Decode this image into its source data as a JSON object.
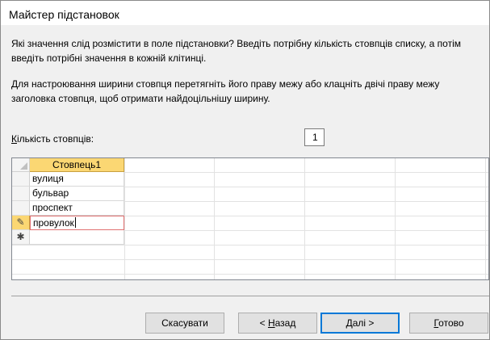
{
  "window": {
    "title": "Майстер підстановок"
  },
  "instructions": {
    "line1a": "Які значення слід розмістити в поле підстановки? Введіть потрібну кількість стовпців списку, а потім",
    "line1b": "введіть потрібні значення в кожній клітинці.",
    "line2a": "Для настроювання ширини стовпця перетягніть його праву межу або клацніть двічі праву межу",
    "line2b": "заголовка стовпця, щоб отримати найдоцільнішу ширину."
  },
  "column_count": {
    "label_accel": "К",
    "label_rest": "ількість стовпців:",
    "value": "1"
  },
  "grid": {
    "column_header": "Стовпець1",
    "rows": [
      "вулиця",
      "бульвар",
      "проспект",
      "провулок",
      ""
    ],
    "row_selectors": [
      "",
      "",
      "",
      "✎",
      "✱"
    ]
  },
  "buttons": {
    "cancel": "Скасувати",
    "back_prefix": "< ",
    "back_accel": "Н",
    "back_rest": "азад",
    "next_accel": "Д",
    "next_rest": "алі >",
    "finish_accel": "Г",
    "finish_rest": "отово"
  }
}
